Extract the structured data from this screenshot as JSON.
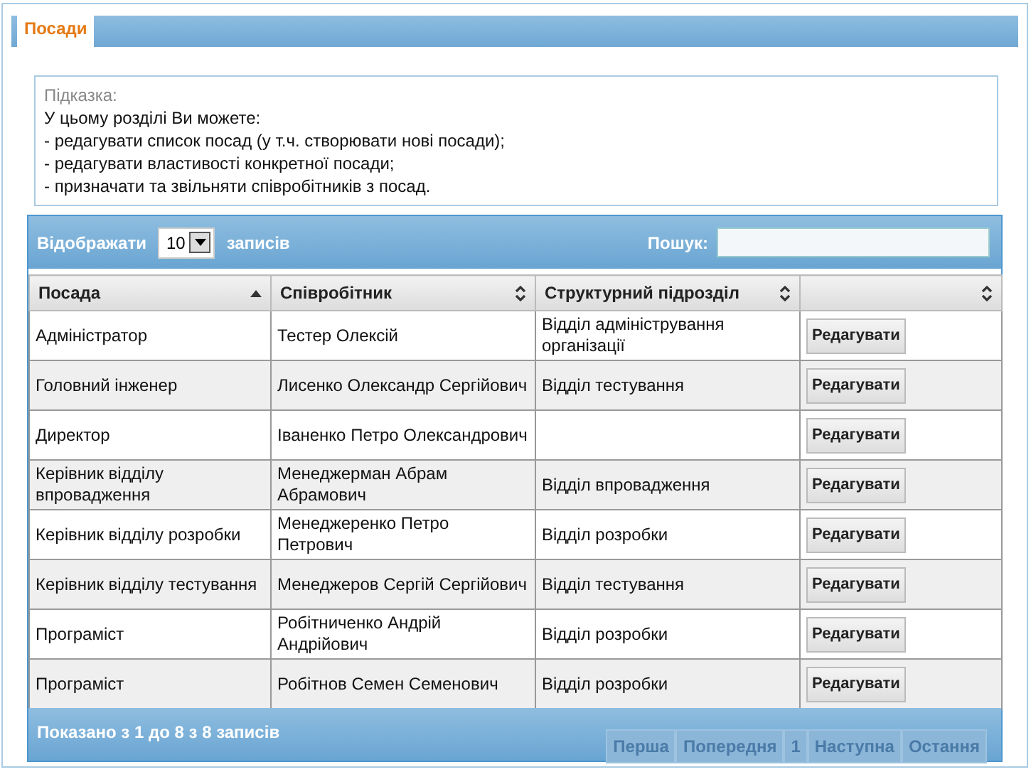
{
  "tabs": [
    {
      "label": "Посади",
      "selected": true
    }
  ],
  "hint": {
    "title": "Підказка:",
    "lines": [
      "У цьому розділі Ви можете:",
      "- редагувати список посад (у т.ч. створювати нові посади);",
      "- редагувати властивості конкретної посади;",
      "- призначати та звільняти співробітників з посад."
    ]
  },
  "toolbar": {
    "show_label": "Відображати",
    "page_size": "10",
    "records_label": "записів",
    "search_label": "Пошук:"
  },
  "table": {
    "columns": [
      {
        "label": "Посада",
        "sorted": true
      },
      {
        "label": "Співробітник",
        "sorted": false
      },
      {
        "label": "Структурний підрозділ",
        "sorted": false
      },
      {
        "sorted": false
      }
    ],
    "rows": [
      {
        "position": "Адміністратор",
        "employee": "Тестер Олексій",
        "department": "Відділ адміністрування організації",
        "action": "Редагувати"
      },
      {
        "position": "Головний інженер",
        "employee": "Лисенко Олександр Сергійович",
        "department": "Відділ тестування",
        "action": "Редагувати"
      },
      {
        "position": "Директор",
        "employee": "Іваненко Петро Олександрович",
        "action": "Редагувати"
      },
      {
        "position": "Керівник відділу впровадження",
        "employee": "Менеджерман Абрам Абрамович",
        "department": "Відділ впровадження",
        "action": "Редагувати"
      },
      {
        "position": "Керівник відділу розробки",
        "employee": "Менеджеренко Петро Петрович",
        "department": "Відділ розробки",
        "action": "Редагувати"
      },
      {
        "position": "Керівник відділу тестування",
        "employee": "Менеджеров Сергій Сергійович",
        "department": "Відділ тестування",
        "action": "Редагувати"
      },
      {
        "position": "Програміст",
        "employee": "Робітниченко Андрій Андрійович",
        "department": "Відділ розробки",
        "action": "Редагувати"
      },
      {
        "position": "Програміст",
        "employee": "Робітнов Семен Семенович",
        "department": "Відділ розробки",
        "action": "Редагувати"
      }
    ]
  },
  "footer": {
    "info": "Показано з 1 до 8 з 8 записів",
    "pages": [
      "Перша",
      "Попередня",
      "1",
      "Наступна",
      "Остання"
    ]
  }
}
